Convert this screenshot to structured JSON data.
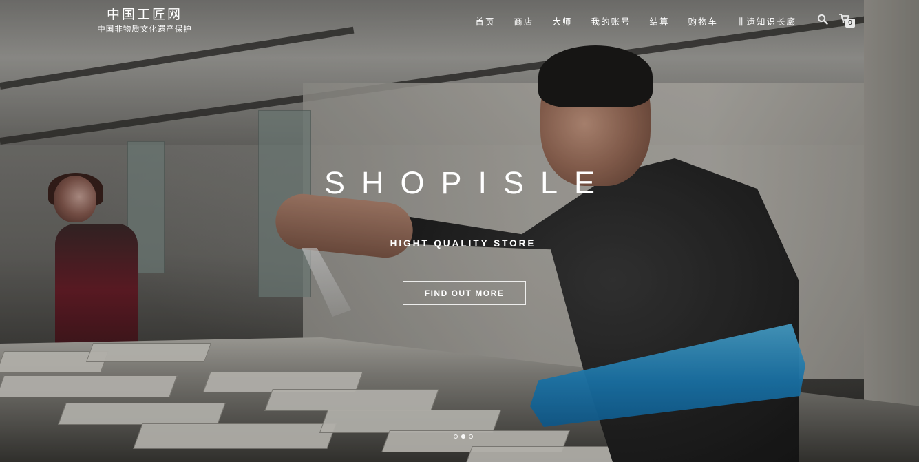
{
  "brand": {
    "title": "中国工匠网",
    "subtitle": "中国非物质文化遗产保护"
  },
  "nav": {
    "items": [
      {
        "label": "首页"
      },
      {
        "label": "商店"
      },
      {
        "label": "大师"
      },
      {
        "label": "我的账号"
      },
      {
        "label": "结算"
      },
      {
        "label": "购物车"
      },
      {
        "label": "非遗知识长廊"
      }
    ]
  },
  "header_icons": {
    "search_icon": "search-icon",
    "cart_icon": "cart-icon",
    "cart_count": "0"
  },
  "hero": {
    "title": "SHOPISLE",
    "subtitle": "HIGHT QUALITY STORE",
    "cta_label": "FIND OUT MORE",
    "slides_total": 3,
    "active_slide": 2
  },
  "colors": {
    "text": "#ffffff",
    "tray_accent": "#1f88c6"
  }
}
